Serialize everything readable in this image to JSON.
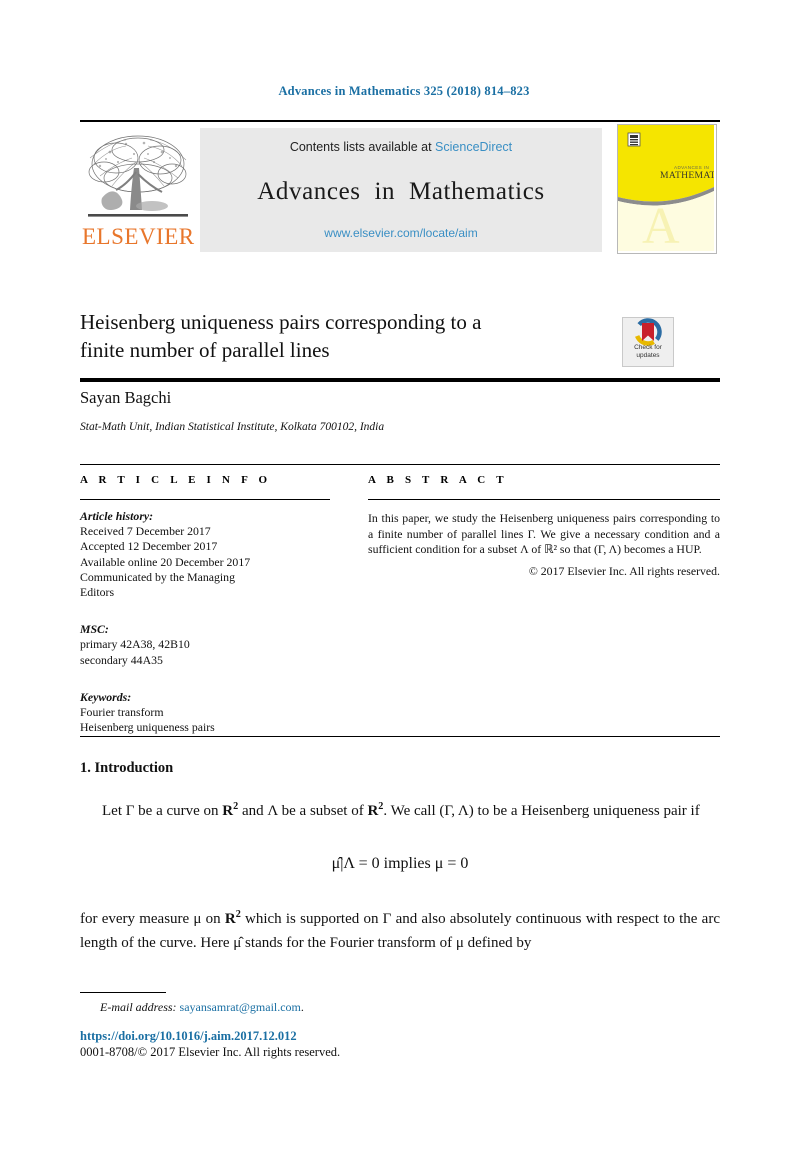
{
  "running_head": "Advances in Mathematics 325 (2018) 814–823",
  "masthead": {
    "contents_prefix": "Contents lists available at ",
    "sciencedirect": "ScienceDirect",
    "journal_title_a": "Advances",
    "journal_title_b": "in",
    "journal_title_c": "Mathematics",
    "journal_url": "www.elsevier.com/locate/aim",
    "publisher_wordmark": "ELSEVIER",
    "publisher_logo_icon": "elsevier-tree-icon",
    "cover_title_small": "ADVANCES IN",
    "cover_title_large": "MATHEMATICS",
    "accent_link_color": "#3a8fc4",
    "elsevier_orange": "#E8762B",
    "cover_yellow": "#F5E500"
  },
  "article": {
    "title_line1": "Heisenberg uniqueness pairs corresponding to a",
    "title_line2": "finite number of parallel lines",
    "author": "Sayan Bagchi",
    "affiliation": "Stat-Math Unit, Indian Statistical Institute, Kolkata 700102, India",
    "crossmark": {
      "icon": "crossmark-badge-icon",
      "label_line1": "Check for",
      "label_line2": "updates"
    }
  },
  "info": {
    "heading": "A R T I C L E   I N F O",
    "history_label": "Article history:",
    "history": [
      "Received 7 December 2017",
      "Accepted 12 December 2017",
      "Available online 20 December 2017",
      "Communicated by the Managing",
      "Editors"
    ],
    "msc_label": "MSC:",
    "msc": [
      "primary 42A38, 42B10",
      "secondary 44A35"
    ],
    "keywords_label": "Keywords:",
    "keywords": [
      "Fourier transform",
      "Heisenberg uniqueness pairs"
    ]
  },
  "abstract": {
    "heading": "A B S T R A C T",
    "text": "In this paper, we study the Heisenberg uniqueness pairs corresponding to a finite number of parallel lines Γ. We give a necessary condition and a sufficient condition for a subset Λ of ℝ² so that (Γ, Λ) becomes a HUP.",
    "copyright": "© 2017 Elsevier Inc. All rights reserved."
  },
  "body": {
    "section_number_title": "1.  Introduction",
    "paragraph1_a": "Let Γ be a curve on ",
    "paragraph1_b": " and Λ be a subset of ",
    "paragraph1_c": ". We call (Γ, Λ) to be a Heisenberg uniqueness pair if",
    "equation": "μ̂|Λ = 0 implies μ = 0",
    "paragraph2_a": "for every measure μ on ",
    "paragraph2_b": " which is supported on Γ and also absolutely continuous with respect to the arc length of the curve. Here μ̂ stands for the Fourier transform of μ defined by",
    "r_symbol": "R",
    "r_exponent": "2"
  },
  "footer": {
    "email_label": "E-mail address:",
    "email": "sayansamrat@gmail.com",
    "email_trailing": ".",
    "doi": "https://doi.org/10.1016/j.aim.2017.12.012",
    "issn_copyright": "0001-8708/© 2017 Elsevier Inc. All rights reserved."
  }
}
